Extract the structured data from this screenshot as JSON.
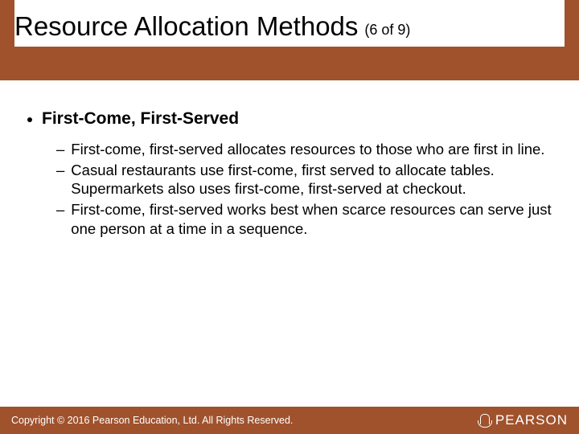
{
  "title": "Resource Allocation Methods",
  "counter": "(6 of 9)",
  "heading": "First-Come, First-Served",
  "subs": [
    "First-come, first-served allocates resources to those who are first in line.",
    "Casual restaurants use first-come, first served to allocate tables. Supermarkets also uses first-come, first-served at checkout.",
    "First-come, first-served works best when scarce resources can serve just one person at a time in a sequence."
  ],
  "copyright": "Copyright © 2016 Pearson Education, Ltd. All Rights Reserved.",
  "brand": "PEARSON"
}
